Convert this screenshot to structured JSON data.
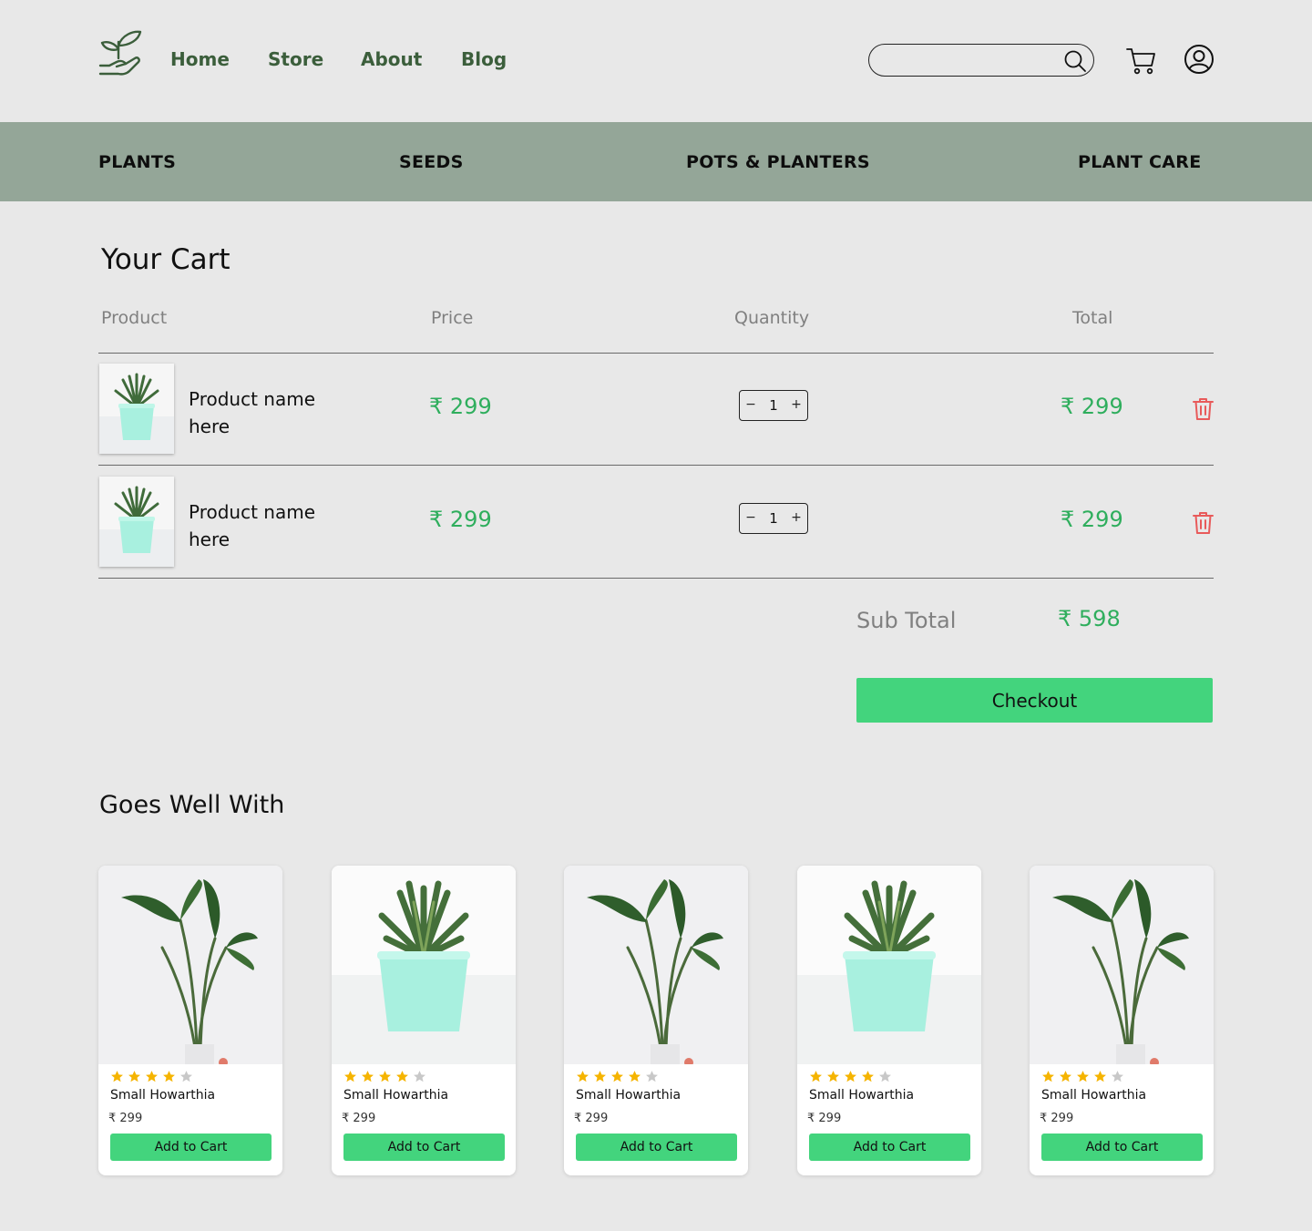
{
  "header": {
    "nav": [
      "Home",
      "Store",
      "About",
      "Blog"
    ],
    "search": {
      "value": "",
      "placeholder": ""
    }
  },
  "categories": [
    "PLANTS",
    "SEEDS",
    "POTS & PLANTERS",
    "PLANT CARE"
  ],
  "cart": {
    "title": "Your Cart",
    "columns": [
      "Product",
      "Price",
      "Quantity",
      "Total"
    ],
    "items": [
      {
        "name": "Product name here",
        "price": "₹ 299",
        "qty": "1",
        "total": "₹ 299",
        "qty_minus": "−",
        "qty_plus": "+"
      },
      {
        "name": "Product name here",
        "price": "₹ 299",
        "qty": "1",
        "total": "₹ 299",
        "qty_minus": "−",
        "qty_plus": "+"
      }
    ],
    "subtotal_label": "Sub Total",
    "subtotal_value": "₹ 598",
    "checkout_label": "Checkout"
  },
  "suggestions": {
    "title": "Goes Well With",
    "items": [
      {
        "name": "Small Howarthia",
        "price": "₹ 299",
        "rating": 4,
        "button": "Add to Cart",
        "image": "monstera"
      },
      {
        "name": "Small Howarthia",
        "price": "₹ 299",
        "rating": 4,
        "button": "Add to Cart",
        "image": "succulent"
      },
      {
        "name": "Small Howarthia",
        "price": "₹ 299",
        "rating": 4,
        "button": "Add to Cart",
        "image": "monstera"
      },
      {
        "name": "Small Howarthia",
        "price": "₹ 299",
        "rating": 4,
        "button": "Add to Cart",
        "image": "succulent"
      },
      {
        "name": "Small Howarthia",
        "price": "₹ 299",
        "rating": 4,
        "button": "Add to Cart",
        "image": "monstera"
      }
    ]
  },
  "colors": {
    "accent_green": "#43d47d",
    "price_green": "#2fae5d",
    "category_bar": "#94a698",
    "nav_text": "#3b5e3b",
    "trash_red": "#e85a5a",
    "star_filled": "#f5b400",
    "star_empty": "#c8c8c8"
  }
}
